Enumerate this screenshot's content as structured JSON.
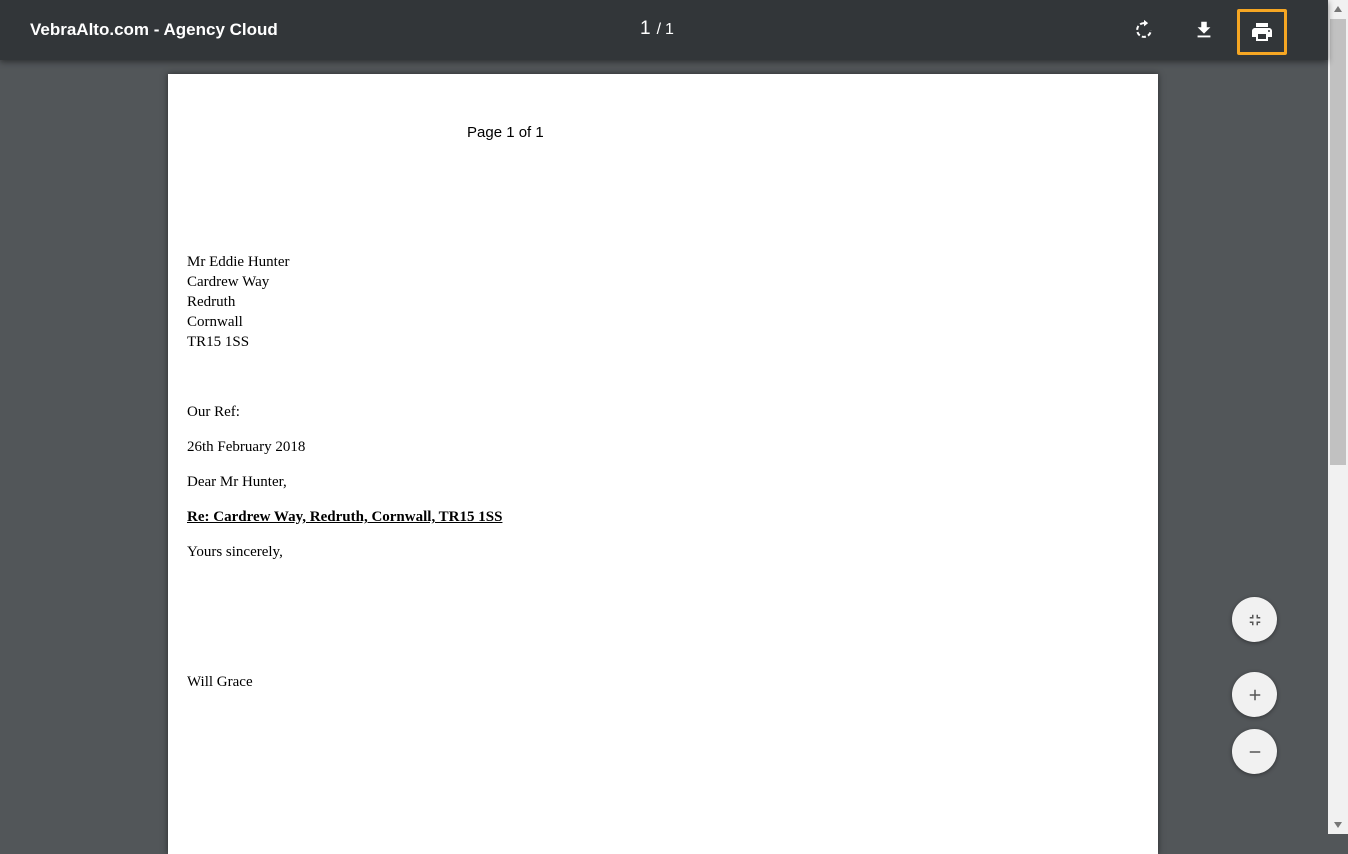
{
  "toolbar": {
    "title": "VebraAlto.com - Agency Cloud",
    "page_current": "1",
    "page_separator": "/",
    "page_total": "1",
    "icons": {
      "rotate": "rotate-icon",
      "download": "download-icon",
      "print": "print-icon"
    },
    "highlight_color": "#f5a623"
  },
  "document": {
    "header": "Page 1 of 1",
    "address": [
      "Mr Eddie Hunter",
      "Cardrew Way",
      "Redruth",
      "Cornwall",
      "TR15 1SS"
    ],
    "our_ref": "Our Ref:",
    "date": "26th February 2018",
    "salutation": "Dear Mr Hunter,",
    "subject": "Re: Cardrew Way, Redruth, Cornwall, TR15 1SS",
    "closing": "Yours sincerely,",
    "signatory": "Will Grace"
  },
  "controls": {
    "fit_icon": "fit-to-page-icon",
    "zoom_in_icon": "zoom-in-icon",
    "zoom_out_icon": "zoom-out-icon"
  }
}
